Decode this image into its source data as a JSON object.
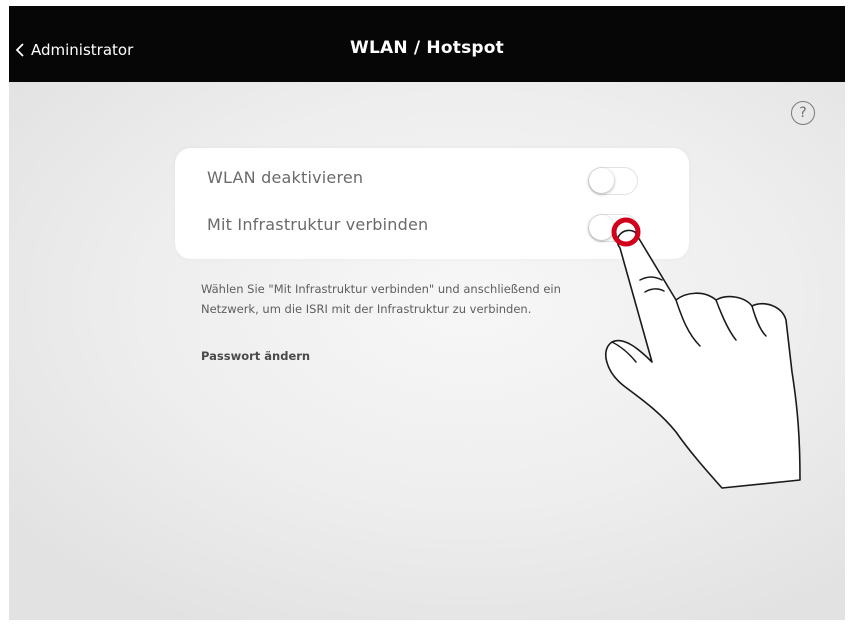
{
  "navbar": {
    "back_label": "Administrator",
    "title": "WLAN / Hotspot"
  },
  "help": {
    "symbol": "?"
  },
  "settings": [
    {
      "label": "WLAN deaktivieren",
      "toggle_on": false
    },
    {
      "label": "Mit Infrastruktur verbinden",
      "toggle_on": false
    }
  ],
  "hint": {
    "line1": "Wählen Sie \"Mit Infrastruktur verbinden\" und anschließend ein",
    "line2": "Netzwerk, um die ISRI mit der Infrastruktur zu verbinden."
  },
  "password_link": "Passwort ändern",
  "colors": {
    "navbar": "#060606",
    "touch_marker": "#d3001b",
    "background": "#eeeeee"
  },
  "icons": {
    "back": "chevron-left-icon",
    "help": "question-circle-icon",
    "gesture": "tapping-hand-icon"
  }
}
